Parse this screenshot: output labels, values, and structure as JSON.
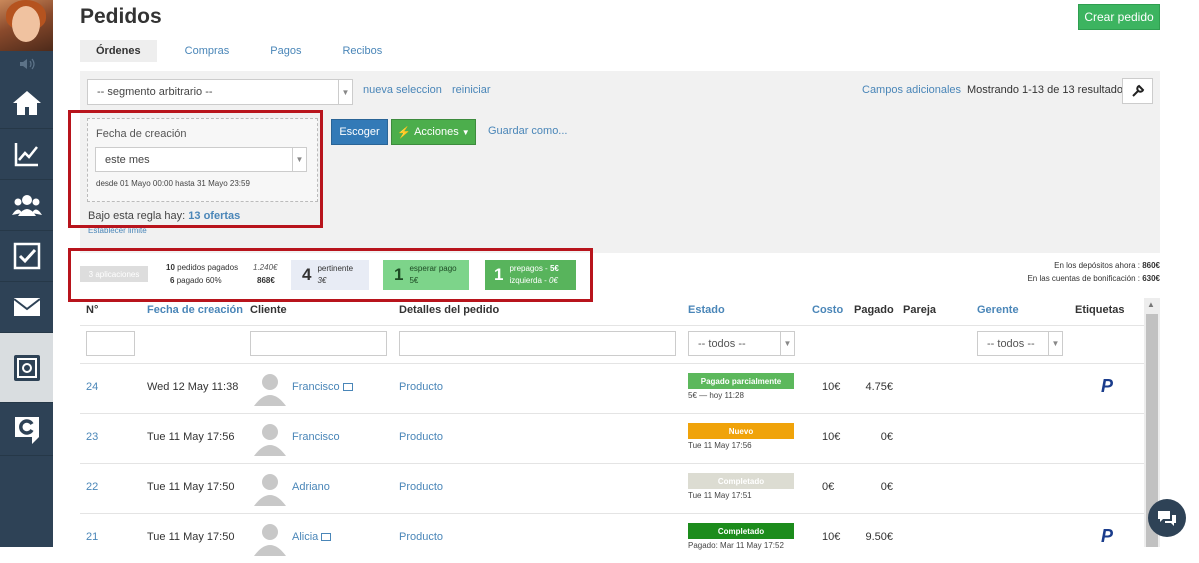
{
  "sidebar": {
    "icons": [
      "user-avatar",
      "speaker-icon",
      "home-icon",
      "chart-icon",
      "users-icon",
      "checkbox-icon",
      "mail-icon",
      "safe-icon",
      "logo-icon"
    ]
  },
  "page": {
    "title": "Pedidos",
    "create_button": "Crear pedido"
  },
  "tabs": [
    "Órdenes",
    "Compras",
    "Pagos",
    "Recibos"
  ],
  "toolbar": {
    "segment_value": "-- segmento arbitrario --",
    "new_selection": "nueva seleccion",
    "reset": "reiniciar",
    "extra_fields": "Campos adicionales",
    "showing": "Mostrando 1-13 de 13 resultados."
  },
  "filter": {
    "label": "Fecha de creación",
    "value": "este mes",
    "range": "desde 01 Mayo 00:00 hasta 31 Mayo 23:59",
    "rule_prefix": "Bajo esta regla hay:",
    "rule_count": "13 ofertas",
    "set_limit": "Establecer limite"
  },
  "actions": {
    "choose": "Escoger",
    "actions": "Acciones",
    "save_as": "Guardar como..."
  },
  "stats": {
    "apps_tag": "3 aplicaciones",
    "paid_count": "10",
    "paid_label": "pedidos pagados",
    "paid_amount": "1.240€",
    "pct_count": "6",
    "pct_label": "pagado 60%",
    "pct_amount": "868€",
    "pertinent_num": "4",
    "pertinent_label": "pertinente",
    "pertinent_amount": "3€",
    "await_num": "1",
    "await_label": "esperar pago",
    "await_amount": "5€",
    "prepay_num": "1",
    "prepay_label": "prepagos",
    "prepay_amount": "5€",
    "left_label": "izquierda",
    "left_amount": "0€",
    "deposits_label": "En los depósitos ahora :",
    "deposits_value": "860€",
    "bonus_label": "En las cuentas de bonificación :",
    "bonus_value": "630€"
  },
  "table": {
    "headers": {
      "num": "N°",
      "date": "Fecha de creación",
      "client": "Cliente",
      "details": "Detalles del pedido",
      "status": "Estado",
      "cost": "Costo",
      "paid": "Pagado",
      "partner": "Pareja",
      "manager": "Gerente",
      "tags": "Etiquetas"
    },
    "status_filter": "-- todos --",
    "manager_filter": "-- todos --",
    "rows": [
      {
        "num": "24",
        "date": "Wed 12 May 11:38",
        "client": "Francisco",
        "details": "Producto",
        "status": "Pagado parcialmente",
        "status_color": "#5cb85c",
        "note": "5€ — hoy 11:28",
        "cost": "10€",
        "paid": "4.75€",
        "paypal": true,
        "id_icon": true
      },
      {
        "num": "23",
        "date": "Tue 11 May 17:56",
        "client": "Francisco",
        "details": "Producto",
        "status": "Nuevo",
        "status_color": "#f0a30a",
        "note": "Tue 11 May 17:56",
        "cost": "10€",
        "paid": "0€",
        "paypal": false,
        "id_icon": false
      },
      {
        "num": "22",
        "date": "Tue 11 May 17:50",
        "client": "Adriano",
        "details": "Producto",
        "status": "Completado",
        "status_color": "#dcdcd2",
        "note": "Tue 11 May 17:51",
        "cost": "0€",
        "paid": "0€",
        "paypal": false,
        "id_icon": false
      },
      {
        "num": "21",
        "date": "Tue 11 May 17:50",
        "client": "Alicia",
        "details": "Producto",
        "status": "Completado",
        "status_color": "#1c8c1c",
        "note": "Pagado: Mar 11 May 17:52",
        "cost": "10€",
        "paid": "9.50€",
        "paypal": true,
        "id_icon": true
      }
    ]
  },
  "colors": {
    "sidebar": "#2e4256",
    "link": "#4a86b8",
    "highlight": "#b8141c",
    "paypal_dark": "#1a3c8c",
    "paypal_light": "#2a9fd8"
  }
}
